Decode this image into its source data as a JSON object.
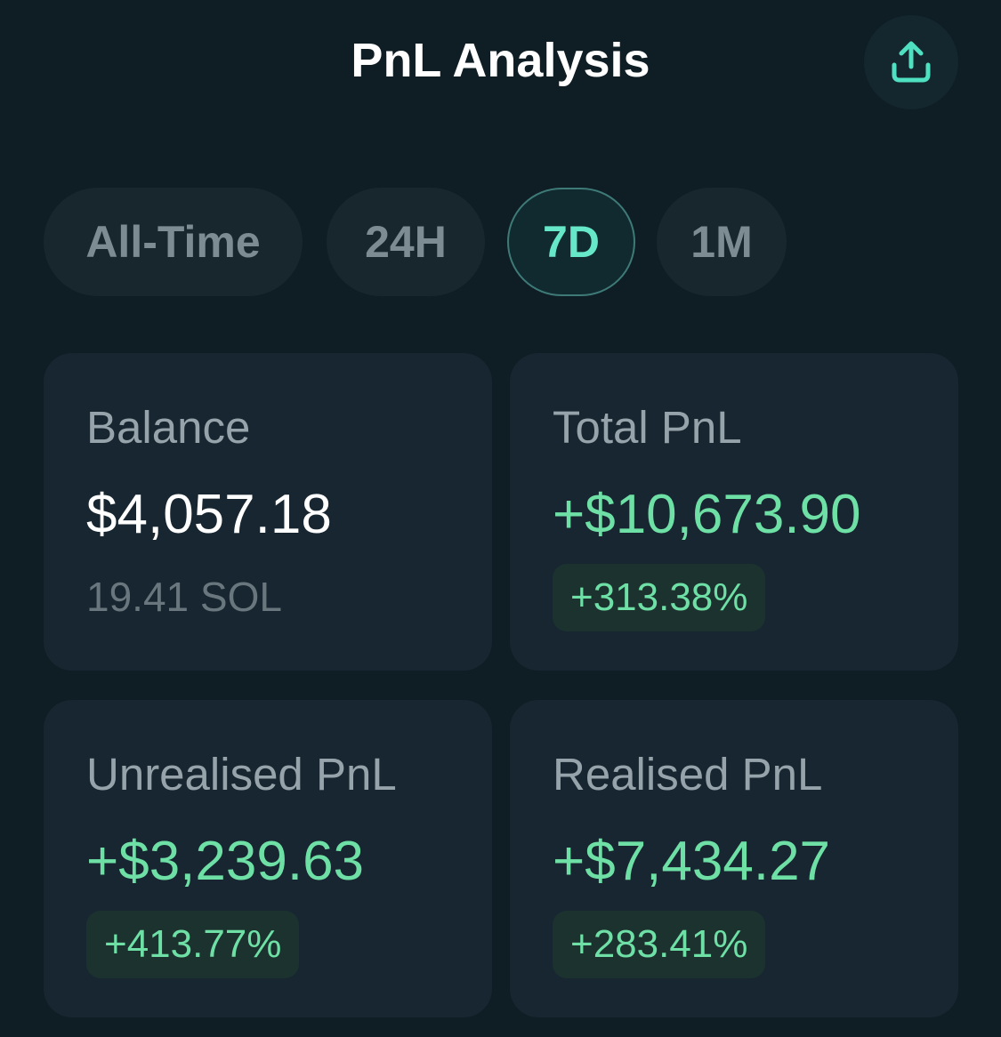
{
  "header": {
    "title": "PnL Analysis",
    "share_icon": "share-upload-icon"
  },
  "tabs": [
    {
      "label": "All-Time",
      "active": false
    },
    {
      "label": "24H",
      "active": false
    },
    {
      "label": "7D",
      "active": true
    },
    {
      "label": "1M",
      "active": false
    }
  ],
  "cards": {
    "balance": {
      "label": "Balance",
      "value": "$4,057.18",
      "sub": "19.41 SOL"
    },
    "total_pnl": {
      "label": "Total PnL",
      "value": "+$10,673.90",
      "pct": "+313.38%"
    },
    "unrealised_pnl": {
      "label": "Unrealised PnL",
      "value": "+$3,239.63",
      "pct": "+413.77%"
    },
    "realised_pnl": {
      "label": "Realised PnL",
      "value": "+$7,434.27",
      "pct": "+283.41%"
    }
  },
  "colors": {
    "background": "#0f1d24",
    "card": "#172630",
    "accent_teal": "#66e8c8",
    "positive_green": "#6ee0a6"
  }
}
